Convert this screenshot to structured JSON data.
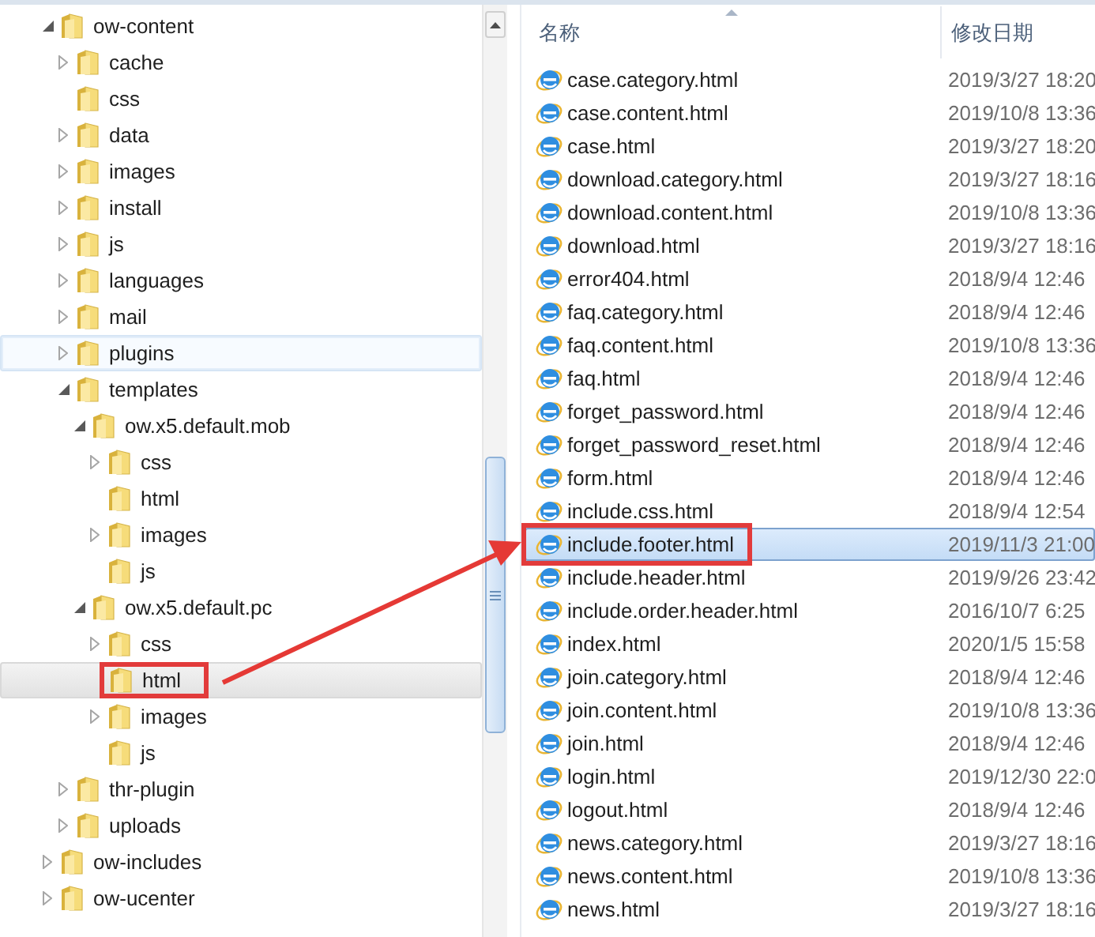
{
  "tree": [
    {
      "label": "ow-content",
      "kind": "branch",
      "expanded": true,
      "selected": false,
      "hovered": false,
      "annotated": false,
      "children": [
        {
          "label": "cache",
          "kind": "branch",
          "expanded": false,
          "selected": false,
          "hovered": false,
          "annotated": false
        },
        {
          "label": "css",
          "kind": "leaf",
          "selected": false,
          "hovered": false,
          "annotated": false
        },
        {
          "label": "data",
          "kind": "branch",
          "expanded": false,
          "selected": false,
          "hovered": false,
          "annotated": false
        },
        {
          "label": "images",
          "kind": "branch",
          "expanded": false,
          "selected": false,
          "hovered": false,
          "annotated": false
        },
        {
          "label": "install",
          "kind": "branch",
          "expanded": false,
          "selected": false,
          "hovered": false,
          "annotated": false
        },
        {
          "label": "js",
          "kind": "branch",
          "expanded": false,
          "selected": false,
          "hovered": false,
          "annotated": false
        },
        {
          "label": "languages",
          "kind": "branch",
          "expanded": false,
          "selected": false,
          "hovered": false,
          "annotated": false
        },
        {
          "label": "mail",
          "kind": "branch",
          "expanded": false,
          "selected": false,
          "hovered": false,
          "annotated": false
        },
        {
          "label": "plugins",
          "kind": "branch",
          "expanded": false,
          "selected": false,
          "hovered": true,
          "annotated": false
        },
        {
          "label": "templates",
          "kind": "branch",
          "expanded": true,
          "selected": false,
          "hovered": false,
          "annotated": false,
          "children": [
            {
              "label": "ow.x5.default.mob",
              "kind": "branch",
              "expanded": true,
              "selected": false,
              "hovered": false,
              "annotated": false,
              "children": [
                {
                  "label": "css",
                  "kind": "branch",
                  "expanded": false,
                  "selected": false,
                  "hovered": false,
                  "annotated": false
                },
                {
                  "label": "html",
                  "kind": "leaf",
                  "selected": false,
                  "hovered": false,
                  "annotated": false
                },
                {
                  "label": "images",
                  "kind": "branch",
                  "expanded": false,
                  "selected": false,
                  "hovered": false,
                  "annotated": false
                },
                {
                  "label": "js",
                  "kind": "leaf",
                  "selected": false,
                  "hovered": false,
                  "annotated": false
                }
              ]
            },
            {
              "label": "ow.x5.default.pc",
              "kind": "branch",
              "expanded": true,
              "selected": false,
              "hovered": false,
              "annotated": false,
              "children": [
                {
                  "label": "css",
                  "kind": "branch",
                  "expanded": false,
                  "selected": false,
                  "hovered": false,
                  "annotated": false
                },
                {
                  "label": "html",
                  "kind": "leaf",
                  "selected": true,
                  "hovered": false,
                  "annotated": true
                },
                {
                  "label": "images",
                  "kind": "branch",
                  "expanded": false,
                  "selected": false,
                  "hovered": false,
                  "annotated": false
                },
                {
                  "label": "js",
                  "kind": "leaf",
                  "selected": false,
                  "hovered": false,
                  "annotated": false
                }
              ]
            }
          ]
        },
        {
          "label": "thr-plugin",
          "kind": "branch",
          "expanded": false,
          "selected": false,
          "hovered": false,
          "annotated": false
        },
        {
          "label": "uploads",
          "kind": "branch",
          "expanded": false,
          "selected": false,
          "hovered": false,
          "annotated": false
        }
      ]
    },
    {
      "label": "ow-includes",
      "kind": "branch",
      "expanded": false,
      "selected": false,
      "hovered": false,
      "annotated": false
    },
    {
      "label": "ow-ucenter",
      "kind": "branch",
      "expanded": false,
      "selected": false,
      "hovered": false,
      "annotated": false
    }
  ],
  "columns": [
    "名称",
    "修改日期"
  ],
  "files": [
    {
      "name": "case.category.html",
      "modified": "2019/3/27 18:20",
      "selected": false,
      "annotated": false
    },
    {
      "name": "case.content.html",
      "modified": "2019/10/8 13:36",
      "selected": false,
      "annotated": false
    },
    {
      "name": "case.html",
      "modified": "2019/3/27 18:20",
      "selected": false,
      "annotated": false
    },
    {
      "name": "download.category.html",
      "modified": "2019/3/27 18:16",
      "selected": false,
      "annotated": false
    },
    {
      "name": "download.content.html",
      "modified": "2019/10/8 13:36",
      "selected": false,
      "annotated": false
    },
    {
      "name": "download.html",
      "modified": "2019/3/27 18:16",
      "selected": false,
      "annotated": false
    },
    {
      "name": "error404.html",
      "modified": "2018/9/4 12:46",
      "selected": false,
      "annotated": false
    },
    {
      "name": "faq.category.html",
      "modified": "2018/9/4 12:46",
      "selected": false,
      "annotated": false
    },
    {
      "name": "faq.content.html",
      "modified": "2019/10/8 13:36",
      "selected": false,
      "annotated": false
    },
    {
      "name": "faq.html",
      "modified": "2018/9/4 12:46",
      "selected": false,
      "annotated": false
    },
    {
      "name": "forget_password.html",
      "modified": "2018/9/4 12:46",
      "selected": false,
      "annotated": false
    },
    {
      "name": "forget_password_reset.html",
      "modified": "2018/9/4 12:46",
      "selected": false,
      "annotated": false
    },
    {
      "name": "form.html",
      "modified": "2018/9/4 12:46",
      "selected": false,
      "annotated": false
    },
    {
      "name": "include.css.html",
      "modified": "2018/9/4 12:54",
      "selected": false,
      "annotated": false
    },
    {
      "name": "include.footer.html",
      "modified": "2019/11/3 21:00",
      "selected": true,
      "annotated": true
    },
    {
      "name": "include.header.html",
      "modified": "2019/9/26 23:42",
      "selected": false,
      "annotated": false
    },
    {
      "name": "include.order.header.html",
      "modified": "2016/10/7 6:25",
      "selected": false,
      "annotated": false
    },
    {
      "name": "index.html",
      "modified": "2020/1/5 15:58",
      "selected": false,
      "annotated": false
    },
    {
      "name": "join.category.html",
      "modified": "2018/9/4 12:46",
      "selected": false,
      "annotated": false
    },
    {
      "name": "join.content.html",
      "modified": "2019/10/8 13:36",
      "selected": false,
      "annotated": false
    },
    {
      "name": "join.html",
      "modified": "2018/9/4 12:46",
      "selected": false,
      "annotated": false
    },
    {
      "name": "login.html",
      "modified": "2019/12/30 22:0",
      "selected": false,
      "annotated": false
    },
    {
      "name": "logout.html",
      "modified": "2018/9/4 12:46",
      "selected": false,
      "annotated": false
    },
    {
      "name": "news.category.html",
      "modified": "2019/3/27 18:16",
      "selected": false,
      "annotated": false
    },
    {
      "name": "news.content.html",
      "modified": "2019/10/8 13:36",
      "selected": false,
      "annotated": false
    },
    {
      "name": "news.html",
      "modified": "2019/3/27 18:16",
      "selected": false,
      "annotated": false
    }
  ]
}
